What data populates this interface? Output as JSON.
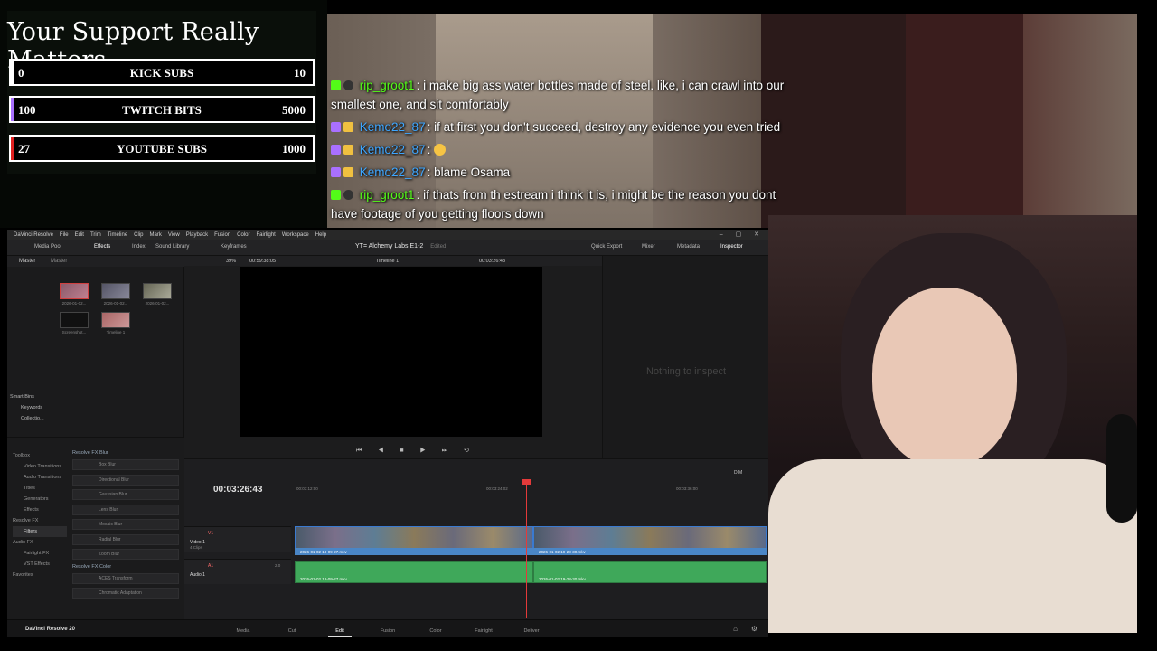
{
  "overlay": {
    "title": "Your Support Really Matters",
    "goals": [
      {
        "low": "0",
        "name": "KICK SUBS",
        "high": "10",
        "color": "#ffffff",
        "progress": 0
      },
      {
        "low": "100",
        "name": "TWITCH BITS",
        "high": "5000",
        "color": "#a970ff",
        "progress": 0.02
      },
      {
        "low": "27",
        "name": "YOUTUBE SUBS",
        "high": "1000",
        "color": "#e02020",
        "progress": 0.027
      }
    ]
  },
  "chat": [
    {
      "platform": "kick",
      "user": "rip_groot1",
      "user_color": "#53fc18",
      "message": ": i make big ass water bottles made of steel. like, i can crawl into our smallest one, and sit comfortably"
    },
    {
      "platform": "twitch",
      "user": "Kemo22_87",
      "user_color": "#3ea6ff",
      "message": ": if at first you don't succeed, destroy any evidence you even tried"
    },
    {
      "platform": "twitch",
      "user": "Kemo22_87",
      "user_color": "#3ea6ff",
      "message": ":"
    },
    {
      "platform": "twitch",
      "user": "Kemo22_87",
      "user_color": "#3ea6ff",
      "message": ": blame Osama"
    },
    {
      "platform": "kick",
      "user": "rip_groot1",
      "user_color": "#53fc18",
      "message": ": if thats from th estream i think it is, i might be the reason you dont have footage of you getting floors down"
    }
  ],
  "resolve": {
    "menu": [
      "DaVinci Resolve",
      "File",
      "Edit",
      "Trim",
      "Timeline",
      "Clip",
      "Mark",
      "View",
      "Playback",
      "Fusion",
      "Color",
      "Fairlight",
      "Workspace",
      "Help"
    ],
    "toolbar_left": [
      "Media Pool",
      "Effects",
      "Index",
      "Sound Library",
      "Keyframes"
    ],
    "toolbar_right": [
      "Quick Export",
      "Mixer",
      "Metadata",
      "Inspector"
    ],
    "project_title": "YT= Alchemy Labs E1-2",
    "project_status": "Edited",
    "bin_tabs": [
      "Master",
      "Master"
    ],
    "clips": [
      "2026-01-02...",
      "2026-01-02...",
      "2026-01-02...",
      "Screenshot...",
      "Timeline 1"
    ],
    "smart_bins": [
      "Smart Bins",
      "Keywords",
      "Collectio..."
    ],
    "viewer": {
      "zoom": "39%",
      "duration": "00:59:38:05",
      "timeline": "Timeline 1",
      "timecode": "00:03:26:43"
    },
    "inspector_empty": "Nothing to inspect",
    "fx_tree": [
      "Toolbox",
      "Video Transitions",
      "Audio Transitions",
      "Titles",
      "Generators",
      "Effects",
      "Resolve FX",
      "Filters",
      "Audio FX",
      "Fairlight FX",
      "VST Effects",
      "Favorites"
    ],
    "fx_group1": "Resolve FX Blur",
    "fx_items1": [
      "Box Blur",
      "Directional Blur",
      "Gaussian Blur",
      "Lens Blur",
      "Mosaic Blur",
      "Radial Blur",
      "Zoom Blur"
    ],
    "fx_group2": "Resolve FX Color",
    "fx_items2": [
      "ACES Transform",
      "Chromatic Adaptation"
    ],
    "timeline": {
      "timecode": "00:03:26:43",
      "ruler": [
        "00:03:12:00",
        "00:03:24:02",
        "00:03:36:00"
      ],
      "video_track": "V1",
      "video_name": "Video 1",
      "video_clips_count": "4 Clips",
      "audio_track": "A1",
      "audio_name": "Audio 1",
      "audio_level": "2.0",
      "clip_a": "2026-01-02 18-09-27.mkv",
      "clip_b": "2026-01-02 19-28-30.mkv",
      "volume_label": "DIM"
    },
    "brand": "DaVinci Resolve 20",
    "pages": [
      "Media",
      "Cut",
      "Edit",
      "Fusion",
      "Color",
      "Fairlight",
      "Deliver"
    ],
    "active_page": "Edit"
  }
}
